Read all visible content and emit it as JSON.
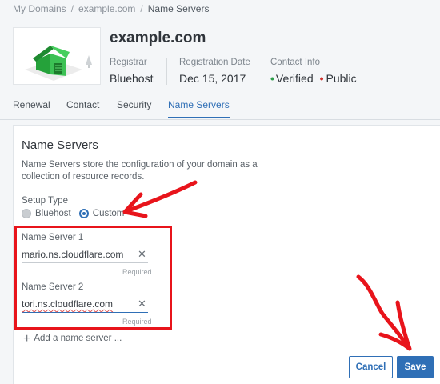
{
  "breadcrumb": {
    "items": [
      "My Domains",
      "example.com",
      "Name Servers"
    ],
    "separator": "/"
  },
  "domain": {
    "name": "example.com",
    "registrar_label": "Registrar",
    "registrar_value": "Bluehost",
    "regdate_label": "Registration Date",
    "regdate_value": "Dec 15, 2017",
    "contact_label": "Contact Info",
    "contact_verified": "Verified",
    "contact_public": "Public",
    "thumbnail_icon": "house-icon"
  },
  "tabs": [
    {
      "label": "Renewal"
    },
    {
      "label": "Contact"
    },
    {
      "label": "Security"
    },
    {
      "label": "Name Servers",
      "active": true
    }
  ],
  "panel": {
    "title": "Name Servers",
    "description": "Name Servers store the configuration of your domain as a collection of resource records.",
    "setup_type_label": "Setup Type",
    "options": [
      {
        "label": "Bluehost",
        "selected": false
      },
      {
        "label": "Custom",
        "selected": true
      }
    ],
    "servers": [
      {
        "label": "Name Server 1",
        "value": "mario.ns.cloudflare.com",
        "required": "Required"
      },
      {
        "label": "Name Server 2",
        "value": "tori.ns.cloudflare.com",
        "required": "Required"
      }
    ],
    "add_label": "Add a name server ...",
    "cancel_label": "Cancel",
    "save_label": "Save"
  },
  "colors": {
    "accent": "#2f6fb6",
    "annotation": "#e8141b",
    "verified": "#2e9e4b",
    "public": "#d0312d"
  }
}
